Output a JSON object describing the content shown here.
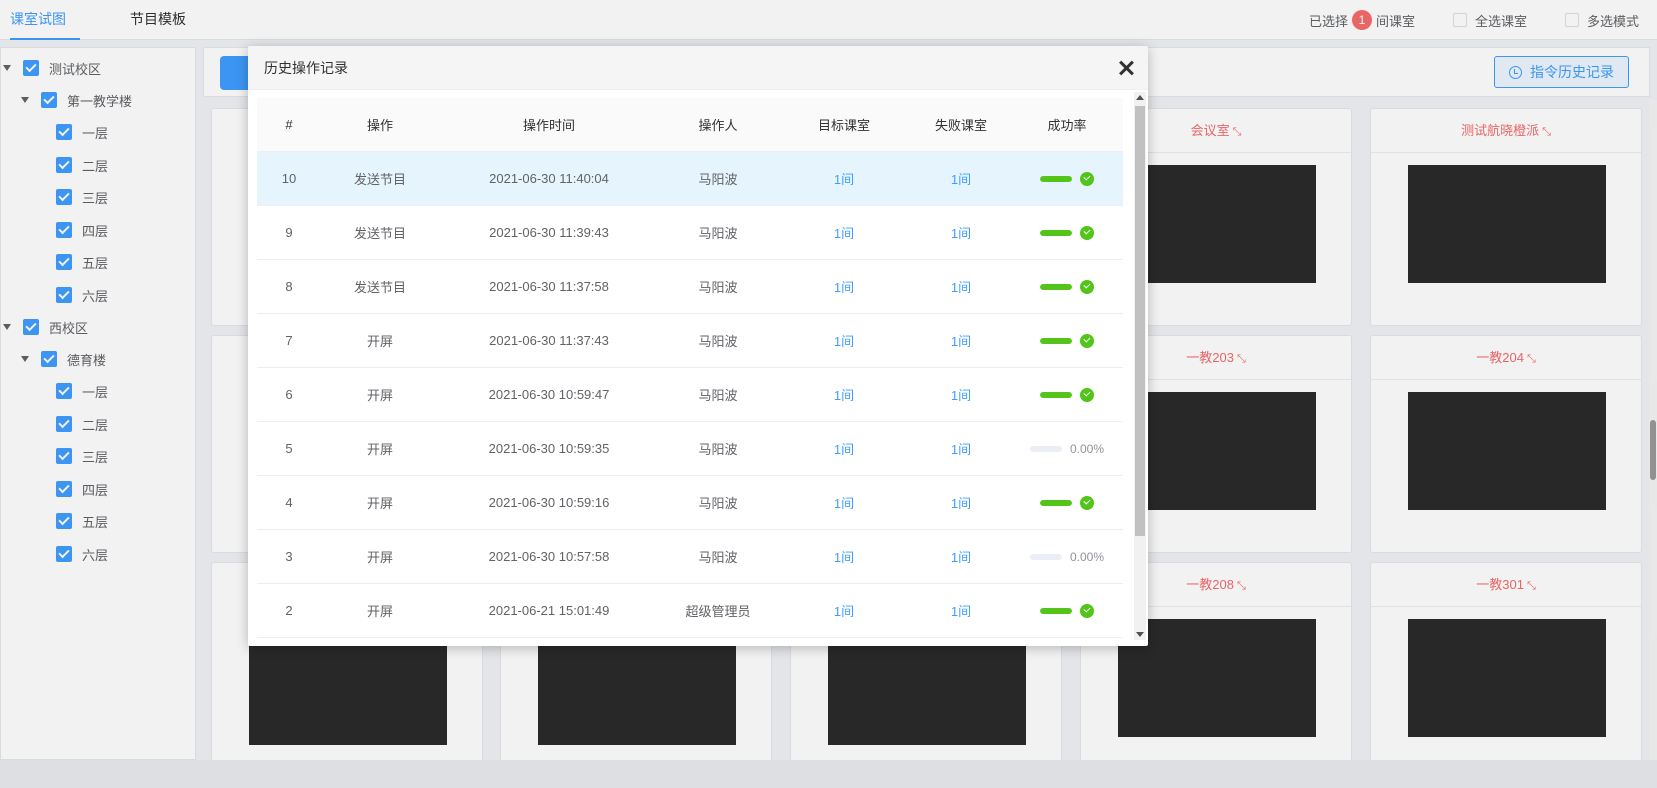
{
  "tabs": [
    {
      "label": "课室试图",
      "active": true
    },
    {
      "label": "节目模板",
      "active": false
    }
  ],
  "selection": {
    "prefix": "已选择",
    "count": "1",
    "suffix": "间课室",
    "select_all": "全选课室",
    "multi_mode": "多选模式"
  },
  "toolbar": {
    "history_button": "指令历史记录"
  },
  "tree": [
    {
      "label": "测试校区",
      "level": 0,
      "expandable": true
    },
    {
      "label": "第一教学楼",
      "level": 1,
      "expandable": true
    },
    {
      "label": "一层",
      "level": 2
    },
    {
      "label": "二层",
      "level": 2
    },
    {
      "label": "三层",
      "level": 2
    },
    {
      "label": "四层",
      "level": 2
    },
    {
      "label": "五层",
      "level": 2
    },
    {
      "label": "六层",
      "level": 2
    },
    {
      "label": "西校区",
      "level": 0,
      "expandable": true
    },
    {
      "label": "德育楼",
      "level": 1,
      "expandable": true
    },
    {
      "label": "一层",
      "level": 2
    },
    {
      "label": "二层",
      "level": 2
    },
    {
      "label": "三层",
      "level": 2
    },
    {
      "label": "四层",
      "level": 2
    },
    {
      "label": "五层",
      "level": 2
    },
    {
      "label": "六层",
      "level": 2
    }
  ],
  "cards": [
    {
      "title": "会议室"
    },
    {
      "title": "测试航晓橙派"
    },
    {
      "title": "一教203"
    },
    {
      "title": "一教204"
    },
    {
      "title": "一教208"
    },
    {
      "title": "一教301"
    }
  ],
  "dialog": {
    "title": "历史操作记录",
    "columns": [
      "#",
      "操作",
      "操作时间",
      "操作人",
      "目标课室",
      "失败课室",
      "成功率"
    ],
    "rows": [
      {
        "id": "10",
        "op": "发送节目",
        "time": "2021-06-30 11:40:04",
        "user": "马阳波",
        "target": "1间",
        "failed": "1间",
        "rate": 1,
        "rate_text": ""
      },
      {
        "id": "9",
        "op": "发送节目",
        "time": "2021-06-30 11:39:43",
        "user": "马阳波",
        "target": "1间",
        "failed": "1间",
        "rate": 1,
        "rate_text": ""
      },
      {
        "id": "8",
        "op": "发送节目",
        "time": "2021-06-30 11:37:58",
        "user": "马阳波",
        "target": "1间",
        "failed": "1间",
        "rate": 1,
        "rate_text": ""
      },
      {
        "id": "7",
        "op": "开屏",
        "time": "2021-06-30 11:37:43",
        "user": "马阳波",
        "target": "1间",
        "failed": "1间",
        "rate": 1,
        "rate_text": ""
      },
      {
        "id": "6",
        "op": "开屏",
        "time": "2021-06-30 10:59:47",
        "user": "马阳波",
        "target": "1间",
        "failed": "1间",
        "rate": 1,
        "rate_text": ""
      },
      {
        "id": "5",
        "op": "开屏",
        "time": "2021-06-30 10:59:35",
        "user": "马阳波",
        "target": "1间",
        "failed": "1间",
        "rate": 0,
        "rate_text": "0.00%"
      },
      {
        "id": "4",
        "op": "开屏",
        "time": "2021-06-30 10:59:16",
        "user": "马阳波",
        "target": "1间",
        "failed": "1间",
        "rate": 1,
        "rate_text": ""
      },
      {
        "id": "3",
        "op": "开屏",
        "time": "2021-06-30 10:57:58",
        "user": "马阳波",
        "target": "1间",
        "failed": "1间",
        "rate": 0,
        "rate_text": "0.00%"
      },
      {
        "id": "2",
        "op": "开屏",
        "time": "2021-06-21 15:01:49",
        "user": "超级管理员",
        "target": "1间",
        "failed": "1间",
        "rate": 1,
        "rate_text": ""
      }
    ]
  },
  "colors": {
    "accent": "#409eff",
    "danger": "#f56c6c",
    "success": "#52c41a"
  }
}
